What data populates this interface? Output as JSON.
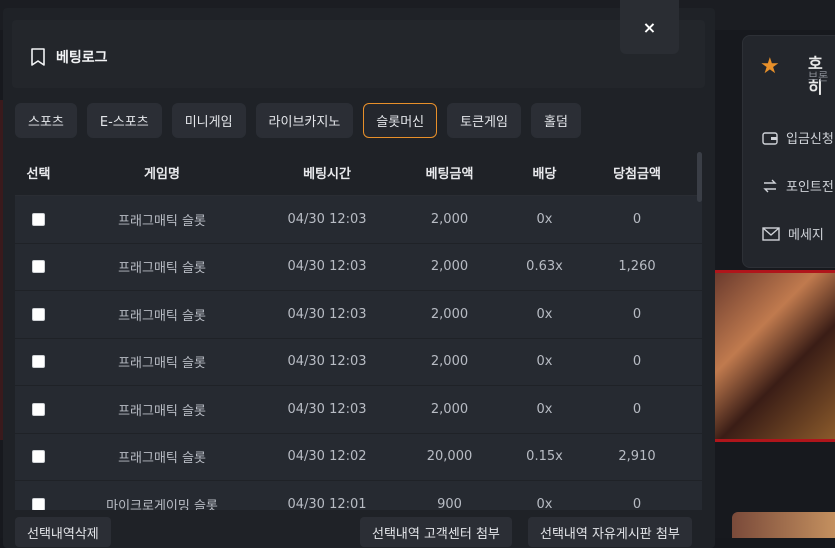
{
  "background": {
    "user_name": "호히",
    "user_sub": "브론",
    "menu": [
      {
        "icon": "wallet-icon",
        "label": "입금신청"
      },
      {
        "icon": "exchange-icon",
        "label": "포인트전"
      },
      {
        "icon": "mail-icon",
        "label": "메세지"
      }
    ]
  },
  "modal": {
    "title": "베팅로그",
    "close_label": "×",
    "tabs": [
      {
        "label": "스포츠",
        "active": false
      },
      {
        "label": "E-스포츠",
        "active": false
      },
      {
        "label": "미니게임",
        "active": false
      },
      {
        "label": "라이브카지노",
        "active": false
      },
      {
        "label": "슬롯머신",
        "active": true
      },
      {
        "label": "토큰게임",
        "active": false
      },
      {
        "label": "홀덤",
        "active": false
      }
    ],
    "columns": {
      "select": "선택",
      "game": "게임명",
      "time": "베팅시간",
      "amount": "베팅금액",
      "odds": "배당",
      "win": "당첨금액"
    },
    "rows": [
      {
        "game": "프래그매틱 슬롯",
        "time": "04/30 12:03",
        "amount": "2,000",
        "odds": "0x",
        "win": "0"
      },
      {
        "game": "프래그매틱 슬롯",
        "time": "04/30 12:03",
        "amount": "2,000",
        "odds": "0.63x",
        "win": "1,260"
      },
      {
        "game": "프래그매틱 슬롯",
        "time": "04/30 12:03",
        "amount": "2,000",
        "odds": "0x",
        "win": "0"
      },
      {
        "game": "프래그매틱 슬롯",
        "time": "04/30 12:03",
        "amount": "2,000",
        "odds": "0x",
        "win": "0"
      },
      {
        "game": "프래그매틱 슬롯",
        "time": "04/30 12:03",
        "amount": "2,000",
        "odds": "0x",
        "win": "0"
      },
      {
        "game": "프래그매틱 슬롯",
        "time": "04/30 12:02",
        "amount": "20,000",
        "odds": "0.15x",
        "win": "2,910"
      },
      {
        "game": "마이크로게이밍 슬롯",
        "time": "04/30 12:01",
        "amount": "900",
        "odds": "0x",
        "win": "0"
      }
    ],
    "footer": {
      "delete_label": "선택내역삭제",
      "support_label": "선택내역 고객센터 첨부",
      "board_label": "선택내역 자유게시판 첨부"
    }
  },
  "colors": {
    "accent": "#e8902a",
    "background": "#1f2227",
    "row": "#262a31"
  }
}
